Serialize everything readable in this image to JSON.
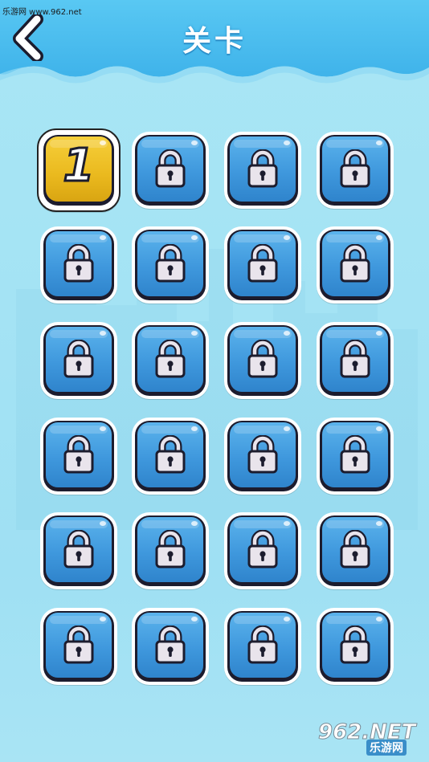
{
  "header": {
    "title": "关卡",
    "back_icon": "chevron-left-icon"
  },
  "watermark": {
    "top_text": "乐游网 www.962.net",
    "bottom_big": "962.NET",
    "bottom_small": "乐游网"
  },
  "colors": {
    "header_blue": "#4fc0f0",
    "tile_blue": "#3f98dd",
    "tile_gold": "#eab91e",
    "background": "#a4e3f4"
  },
  "levels": [
    {
      "label": "1",
      "state": "unlocked",
      "icon": "number"
    },
    {
      "label": "",
      "state": "locked",
      "icon": "lock-icon"
    },
    {
      "label": "",
      "state": "locked",
      "icon": "lock-icon"
    },
    {
      "label": "",
      "state": "locked",
      "icon": "lock-icon"
    },
    {
      "label": "",
      "state": "locked",
      "icon": "lock-icon"
    },
    {
      "label": "",
      "state": "locked",
      "icon": "lock-icon"
    },
    {
      "label": "",
      "state": "locked",
      "icon": "lock-icon"
    },
    {
      "label": "",
      "state": "locked",
      "icon": "lock-icon"
    },
    {
      "label": "",
      "state": "locked",
      "icon": "lock-icon"
    },
    {
      "label": "",
      "state": "locked",
      "icon": "lock-icon"
    },
    {
      "label": "",
      "state": "locked",
      "icon": "lock-icon"
    },
    {
      "label": "",
      "state": "locked",
      "icon": "lock-icon"
    },
    {
      "label": "",
      "state": "locked",
      "icon": "lock-icon"
    },
    {
      "label": "",
      "state": "locked",
      "icon": "lock-icon"
    },
    {
      "label": "",
      "state": "locked",
      "icon": "lock-icon"
    },
    {
      "label": "",
      "state": "locked",
      "icon": "lock-icon"
    },
    {
      "label": "",
      "state": "locked",
      "icon": "lock-icon"
    },
    {
      "label": "",
      "state": "locked",
      "icon": "lock-icon"
    },
    {
      "label": "",
      "state": "locked",
      "icon": "lock-icon"
    },
    {
      "label": "",
      "state": "locked",
      "icon": "lock-icon"
    },
    {
      "label": "",
      "state": "locked",
      "icon": "lock-icon"
    },
    {
      "label": "",
      "state": "locked",
      "icon": "lock-icon"
    },
    {
      "label": "",
      "state": "locked",
      "icon": "lock-icon"
    },
    {
      "label": "",
      "state": "locked",
      "icon": "lock-icon"
    }
  ]
}
